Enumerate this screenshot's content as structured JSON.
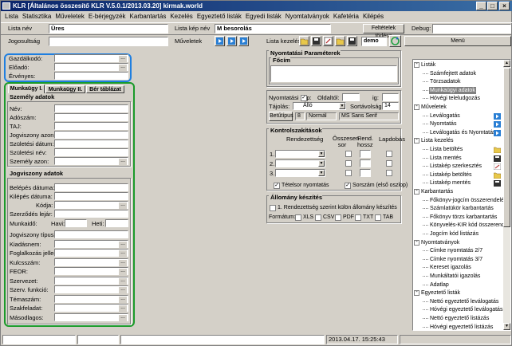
{
  "title": "KLR  [Általános összesítő KLR V.5.0.1/2013.03.20]  kirmak.world",
  "menu": [
    "Lista",
    "Statisztika",
    "Műveletek",
    "E-bérjegyzék",
    "Karbantartás",
    "Kezelés",
    "Egyeztető listák",
    "Egyedi listák",
    "Nyomtatványok",
    "Kafetéria",
    "Kilépés"
  ],
  "toolbar": {
    "listanev_label": "Lista név",
    "listanev_value": "Üres",
    "listakepnev_label": "Lista kép név",
    "listakepnev_value": "M besorolás",
    "feltetelek_torlese": "Feltételek törlése",
    "debug_label": "Debug:",
    "jogosultsag_label": "Jogosultság",
    "muveletek_label": "Műveletek",
    "listakezeles_label": "Lista kezelés",
    "demo_value": "demo",
    "menu_label": "Menü"
  },
  "topleft": {
    "gazdalkodo": "Gazdálkodó:",
    "eloado": "Előadó:",
    "ervenyes": "Érvényes:"
  },
  "tabs": [
    "Munkaügy I.",
    "Munkaügy II.",
    "Bér táblázat"
  ],
  "szemely": {
    "header": "Személy adatok",
    "fields": [
      "Név:",
      "Adószám:",
      "TAJ:",
      "Jogviszony azon:",
      "Születési dátum:",
      "Születési név:",
      "Személy azon:"
    ]
  },
  "jogviszony": {
    "header": "Jogviszony adatok",
    "belepes": "Belépés dátuma:",
    "kilepes": "Kilépés dátuma:",
    "kodja": "Kódja:",
    "szerzodes": "Szerződés lejár:",
    "munkaido": "Munkaidő:",
    "havi": "Havi:",
    "heti": "Heti:",
    "fields": [
      "Jogviszony típus:",
      "Kiadásnem:",
      "Foglalkozás jelleg:",
      "Kulcsszám:",
      "FEOR:",
      "Szervezet:",
      "Szerv. funkció:",
      "Témaszám:",
      "Szakfeladat:",
      "Másodlagos:"
    ]
  },
  "nyomtatasi": {
    "header": "Nyomtatási Paraméterek",
    "focim": "Főcím",
    "nyomtatasi_kep": "Nyomtatási kép:",
    "oldaltol": "Oldaltól:",
    "ig": "ig:",
    "tajolas": "Tájolás:",
    "tajolas_value": "Álló",
    "sortavolsag": "Sortávolság:",
    "sortavolsag_value": "14",
    "betutipus": "Betűtípus",
    "betumeret": "8",
    "betustilus": "Normál",
    "betunev": "MS Sans Serif"
  },
  "kontroll": {
    "header": "Kontrolszakítások",
    "rendezettseg": "Rendezettség",
    "osszesen": "Összesen sor",
    "rend_hossz": "Rend. hossz",
    "lapdobas": "Lapdobás",
    "rows": [
      "1.",
      "2.",
      "3."
    ],
    "tetelsor": "Tételsor nyomtatás",
    "sorszam": "Sorszám (első oszlop)"
  },
  "allomany": {
    "header": "Állomány készítés",
    "rendezettseg_szerint": "1. Rendezettség szerint külön állomány készítés",
    "formatum": "Formátum:",
    "formats": [
      "XLS",
      "CSV",
      "PDF",
      "TXT",
      "TAB"
    ]
  },
  "tree": [
    {
      "label": "Listák",
      "level": 0,
      "expander": "-"
    },
    {
      "label": "Számfejtett adatok",
      "level": 1
    },
    {
      "label": "Törzsadatok",
      "level": 1
    },
    {
      "label": "Munkaügyi adatok",
      "level": 1,
      "selected": true
    },
    {
      "label": "Hóvégi teleludgozás",
      "level": 1
    },
    {
      "label": "Műveletek",
      "level": 0,
      "expander": "-"
    },
    {
      "label": "Leválogatás",
      "level": 1,
      "icon": "arrow"
    },
    {
      "label": "Nyomtatás",
      "level": 1,
      "icon": "arrow"
    },
    {
      "label": "Leválogatás és Nyomtatás",
      "level": 1,
      "icon": "arrow"
    },
    {
      "label": "Lista kezelés",
      "level": 0,
      "expander": "-"
    },
    {
      "label": "Lista betöltés",
      "level": 1,
      "icon": "folder"
    },
    {
      "label": "Lista mentés",
      "level": 1,
      "icon": "disk"
    },
    {
      "label": "Listakép szerkesztés",
      "level": 1,
      "icon": "edit"
    },
    {
      "label": "Listakép betöltés",
      "level": 1,
      "icon": "folder"
    },
    {
      "label": "Listakép mentés",
      "level": 1,
      "icon": "disk"
    },
    {
      "label": "Karbantartás",
      "level": 0,
      "expander": "-"
    },
    {
      "label": "Főkönyv-jogcím összerendelés",
      "level": 1
    },
    {
      "label": "Számlatükör karbantartás",
      "level": 1
    },
    {
      "label": "Főkönyv törzs karbantartás",
      "level": 1
    },
    {
      "label": "Könyvelés-KIR kód összerend.",
      "level": 1
    },
    {
      "label": "Jogcím kód listázás",
      "level": 1
    },
    {
      "label": "Nyomtatványok",
      "level": 0,
      "expander": "-"
    },
    {
      "label": "Címke nyomtatás 2/7",
      "level": 1
    },
    {
      "label": "Címke nyomtatás 3/7",
      "level": 1
    },
    {
      "label": "Kereset igazolás",
      "level": 1
    },
    {
      "label": "Munkáltatói igazolás",
      "level": 1
    },
    {
      "label": "Adatlap",
      "level": 1
    },
    {
      "label": "Egyeztető listák",
      "level": 0,
      "expander": "-"
    },
    {
      "label": "Nettó egyeztető leválogatás",
      "level": 1
    },
    {
      "label": "Hóvégi egyeztető leválogatás",
      "level": 1
    },
    {
      "label": "Nettó egyeztető listázás",
      "level": 1
    },
    {
      "label": "Hóvégi egyeztető listázás",
      "level": 1
    }
  ],
  "status": {
    "datetime": "2013.04.17.  15:25:43"
  },
  "colors": {
    "blue_highlight": "#1f7fe0",
    "green_highlight": "#1a9a2a",
    "title_bar": "#0a246a"
  }
}
